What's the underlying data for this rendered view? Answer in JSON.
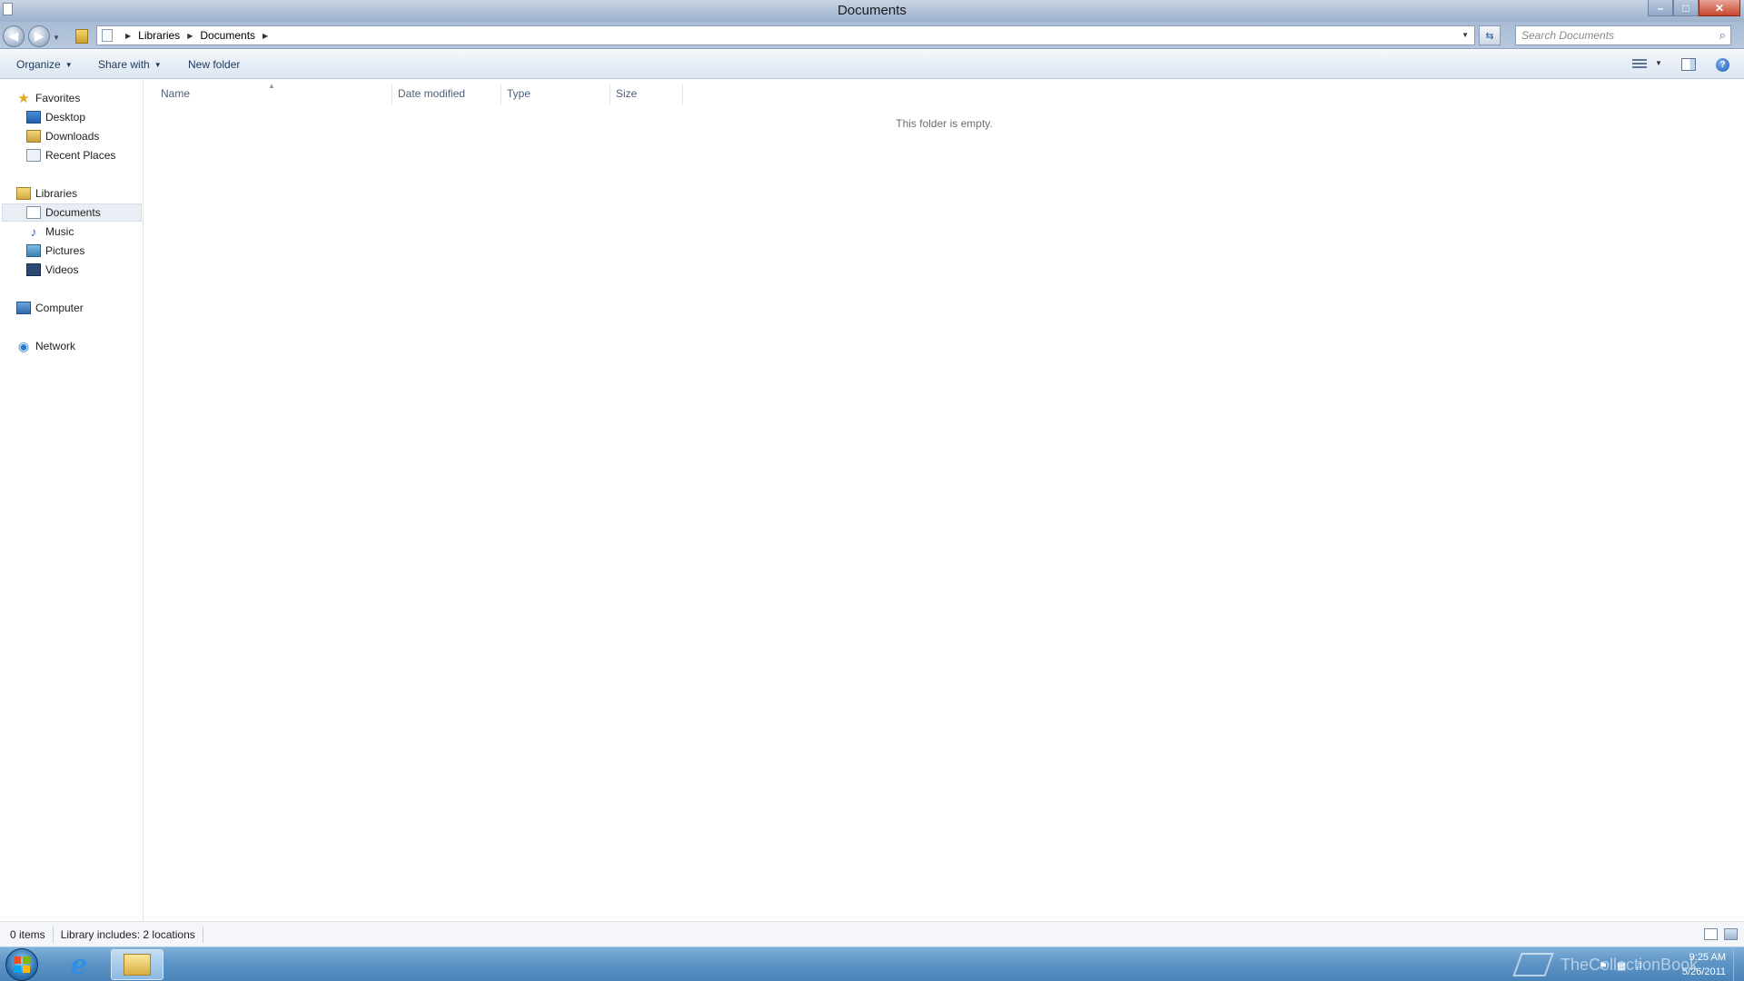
{
  "window": {
    "title": "Documents",
    "controls": {
      "minimize": "–",
      "maximize": "□",
      "close": "✕"
    }
  },
  "address": {
    "breadcrumb": [
      "Libraries",
      "Documents"
    ],
    "search_placeholder": "Search Documents"
  },
  "toolbar": {
    "organize": "Organize",
    "share_with": "Share with",
    "new_folder": "New folder",
    "help": "?"
  },
  "nav": {
    "favorites": {
      "label": "Favorites",
      "items": [
        "Desktop",
        "Downloads",
        "Recent Places"
      ]
    },
    "libraries": {
      "label": "Libraries",
      "items": [
        "Documents",
        "Music",
        "Pictures",
        "Videos"
      ],
      "selected": "Documents"
    },
    "computer": "Computer",
    "network": "Network"
  },
  "columns": {
    "name": "Name",
    "date_modified": "Date modified",
    "type": "Type",
    "size": "Size"
  },
  "content": {
    "empty_message": "This folder is empty."
  },
  "status": {
    "items": "0 items",
    "library_label": "Library includes:",
    "locations": "2 locations"
  },
  "taskbar": {
    "watermark": "TheCollectionBook",
    "time": "9:25 AM",
    "date": "5/26/2011"
  },
  "colors": {
    "accent": "#1e395b",
    "taskbar": "#5e95c6",
    "close_button": "#c7452e",
    "windows_logo": [
      "#f25022",
      "#7fba00",
      "#00a4ef",
      "#ffb900"
    ]
  },
  "icons": {
    "favorites": "star-icon",
    "desktop": "desktop-icon",
    "downloads": "downloads-icon",
    "recent": "recent-places-icon",
    "libraries": "libraries-icon",
    "documents": "documents-icon",
    "music": "music-icon",
    "pictures": "pictures-icon",
    "videos": "videos-icon",
    "computer": "computer-icon",
    "network": "network-icon"
  }
}
